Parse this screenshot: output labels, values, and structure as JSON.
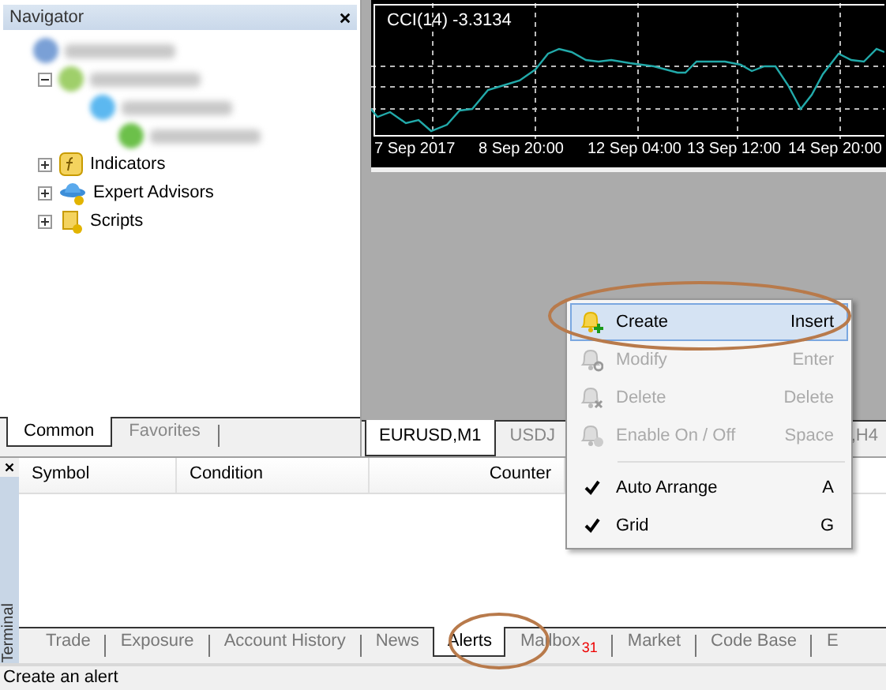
{
  "navigator": {
    "title": "Navigator",
    "tree": [
      {
        "kind": "blurred",
        "children": [
          {
            "kind": "blurred",
            "expanded": true,
            "children": [
              {
                "kind": "blurred",
                "children": [
                  {
                    "kind": "blurred"
                  }
                ]
              }
            ]
          },
          {
            "kind": "folder",
            "label": "Indicators",
            "expanded": false
          },
          {
            "kind": "folder",
            "label": "Expert Advisors",
            "expanded": false
          },
          {
            "kind": "folder",
            "label": "Scripts",
            "expanded": false
          }
        ]
      }
    ],
    "tabs": [
      {
        "label": "Common",
        "selected": true
      },
      {
        "label": "Favorites",
        "selected": false
      }
    ]
  },
  "chart": {
    "indicator": "CCI(14) -3.3134",
    "dates": [
      "7 Sep 2017",
      "8 Sep 20:00",
      "12 Sep 04:00",
      "13 Sep 12:00",
      "14 Sep 20:00"
    ]
  },
  "chart_tabs": [
    {
      "label": "EURUSD,M1",
      "selected": true
    },
    {
      "label": "USDJ",
      "selected": false
    },
    {
      "label": ",H4",
      "selected": false
    }
  ],
  "context_menu": [
    {
      "kind": "item",
      "label": "Create",
      "shortcut": "Insert",
      "disabled": false,
      "selected": true
    },
    {
      "kind": "item",
      "label": "Modify",
      "shortcut": "Enter",
      "disabled": true,
      "selected": false
    },
    {
      "kind": "item",
      "label": "Delete",
      "shortcut": "Delete",
      "disabled": true,
      "selected": false
    },
    {
      "kind": "item",
      "label": "Enable On / Off",
      "shortcut": "Space",
      "disabled": true,
      "selected": false
    },
    {
      "kind": "separator"
    },
    {
      "kind": "check",
      "label": "Auto Arrange",
      "shortcut": "A",
      "checked": true
    },
    {
      "kind": "check",
      "label": "Grid",
      "shortcut": "G",
      "checked": true
    }
  ],
  "terminal": {
    "title": "Terminal",
    "columns": [
      "Symbol",
      "Condition",
      "Counter"
    ],
    "tabs": [
      {
        "label": "Trade",
        "selected": false
      },
      {
        "label": "Exposure",
        "selected": false
      },
      {
        "label": "Account History",
        "selected": false
      },
      {
        "label": "News",
        "selected": false
      },
      {
        "label": "Alerts",
        "selected": true
      },
      {
        "label": "Mailbox",
        "badge": "31",
        "selected": false
      },
      {
        "label": "Market",
        "selected": false
      },
      {
        "label": "Code Base",
        "selected": false
      },
      {
        "label": "E",
        "selected": false
      }
    ]
  },
  "status_bar": "Create an alert"
}
